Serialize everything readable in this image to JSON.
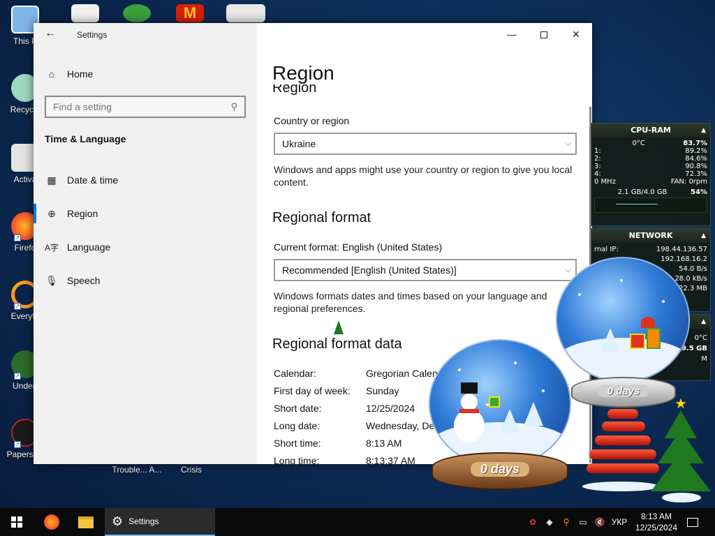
{
  "desktop": {
    "icons": [
      {
        "label": "This P",
        "color": "#7fb6e8"
      },
      {
        "label": "Recycle",
        "color": "#9fd9c0"
      },
      {
        "label": "Activa",
        "color": "#e4e4e4"
      },
      {
        "label": "Firefo",
        "color": "#ff7a18"
      },
      {
        "label": "Everyth",
        "color": "#ff9a1a"
      },
      {
        "label": "Undert",
        "color": "#2c6b2c"
      },
      {
        "label": "Papers, P",
        "color": "#1a1a1a"
      }
    ],
    "bottom_labels": [
      "Trouble... A...",
      "Crisis"
    ]
  },
  "window": {
    "title": "Settings",
    "sidebar": {
      "home": "Home",
      "search_placeholder": "Find a setting",
      "section": "Time & Language",
      "items": [
        {
          "label": "Date & time",
          "icon": "calendar-clock-icon"
        },
        {
          "label": "Region",
          "icon": "globe-icon",
          "selected": true
        },
        {
          "label": "Language",
          "icon": "language-icon"
        },
        {
          "label": "Speech",
          "icon": "microphone-icon"
        }
      ]
    },
    "main": {
      "title": "Region",
      "subtitle_cut": "Region",
      "country_label": "Country or region",
      "country_value": "Ukraine",
      "country_desc": "Windows and apps might use your country or region to give you local content.",
      "format_heading": "Regional format",
      "current_format": "Current format: English (United States)",
      "format_value": "Recommended [English (United States)]",
      "format_desc": "Windows formats dates and times based on your language and regional preferences.",
      "data_heading": "Regional format data",
      "rows": [
        {
          "key": "Calendar:",
          "value": "Gregorian Calend"
        },
        {
          "key": "First day of week:",
          "value": "Sunday"
        },
        {
          "key": "Short date:",
          "value": "12/25/2024"
        },
        {
          "key": "Long date:",
          "value": "Wednesday, De"
        },
        {
          "key": "Short time:",
          "value": "8:13 AM"
        },
        {
          "key": "Long time:",
          "value": "8:13:37 AM"
        }
      ]
    }
  },
  "gadgets": {
    "cpu": {
      "title": "CPU-RAM",
      "temp": "0°C",
      "total": "83.7%",
      "cores": [
        {
          "label": "1:",
          "value": "89.2%"
        },
        {
          "label": "2:",
          "value": "84.6%"
        },
        {
          "label": "3:",
          "value": "90.8%"
        },
        {
          "label": "4:",
          "value": "72.3%"
        }
      ],
      "freq": "0 MHz",
      "fan": "FAN: 0rpm",
      "ram": "2.1 GB/4.0 GB",
      "ram_pct": "54%"
    },
    "network": {
      "title": "NETWORK",
      "rows": [
        {
          "label": "rnal IP:",
          "value": "198.44.136.57"
        },
        {
          "label": "",
          "value": "192.168.16.2"
        },
        {
          "label": "",
          "value": "54.0 B/s"
        },
        {
          "label": "",
          "value": "28.0 kB/s"
        },
        {
          "label": "",
          "value": "22.3 MB"
        }
      ]
    },
    "partial": {
      "temp": "0°C",
      "value": "9.5 GB",
      "m": "M"
    }
  },
  "decor": {
    "globe_big_label": "0 days",
    "globe_small_label": "0 days"
  },
  "taskbar": {
    "active_app": "Settings",
    "lang": "УКР",
    "time": "8:13 AM",
    "date": "12/25/2024"
  }
}
